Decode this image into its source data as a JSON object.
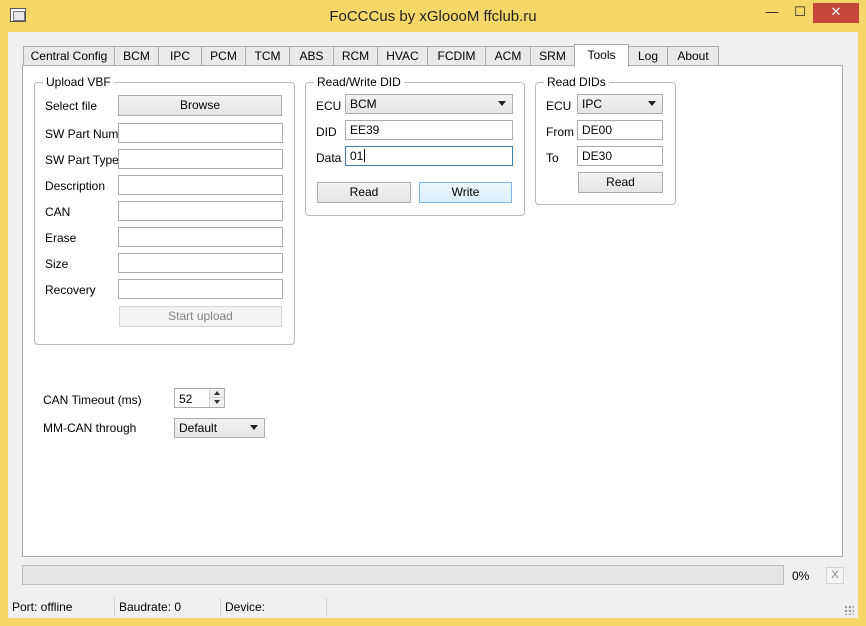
{
  "window": {
    "title": "FoCCCus by xGloooM ffclub.ru",
    "minimize_glyph": "—",
    "maximize_glyph": "☐",
    "close_glyph": "✕"
  },
  "tabs": [
    {
      "label": "Central Config",
      "active": false
    },
    {
      "label": "BCM",
      "active": false
    },
    {
      "label": "IPC",
      "active": false
    },
    {
      "label": "PCM",
      "active": false
    },
    {
      "label": "TCM",
      "active": false
    },
    {
      "label": "ABS",
      "active": false
    },
    {
      "label": "RCM",
      "active": false
    },
    {
      "label": "HVAC",
      "active": false
    },
    {
      "label": "FCDIM",
      "active": false
    },
    {
      "label": "ACM",
      "active": false
    },
    {
      "label": "SRM",
      "active": false
    },
    {
      "label": "Tools",
      "active": true
    },
    {
      "label": "Log",
      "active": false
    },
    {
      "label": "About",
      "active": false
    }
  ],
  "upload_vbf": {
    "title": "Upload VBF",
    "select_file_label": "Select file",
    "browse_label": "Browse",
    "fields": [
      {
        "label": "SW Part Num",
        "value": ""
      },
      {
        "label": "SW Part Type",
        "value": ""
      },
      {
        "label": "Description",
        "value": ""
      },
      {
        "label": "CAN",
        "value": ""
      },
      {
        "label": "Erase",
        "value": ""
      },
      {
        "label": "Size",
        "value": ""
      },
      {
        "label": "Recovery",
        "value": ""
      }
    ],
    "start_upload_label": "Start upload"
  },
  "can_timeout": {
    "label": "CAN Timeout (ms)",
    "value": "52"
  },
  "mm_can": {
    "label": "MM-CAN through",
    "value": "Default"
  },
  "read_write_did": {
    "title": "Read/Write DID",
    "ecu_label": "ECU",
    "ecu_value": "BCM",
    "did_label": "DID",
    "did_value": "EE39",
    "data_label": "Data",
    "data_value": "01",
    "read_label": "Read",
    "write_label": "Write"
  },
  "read_dids": {
    "title": "Read DIDs",
    "ecu_label": "ECU",
    "ecu_value": "IPC",
    "from_label": "From",
    "from_value": "DE00",
    "to_label": "To",
    "to_value": "DE30",
    "read_label": "Read"
  },
  "progress": {
    "value_percent": 0,
    "label": "0%",
    "cancel_label": "X"
  },
  "status": {
    "port": "Port: offline",
    "baudrate": "Baudrate: 0",
    "device": "Device:"
  },
  "colors": {
    "titlebar": "#f7d768",
    "close_button": "#c7463b",
    "focus_border": "#3c7fb1",
    "progress_fill": "#06b025"
  }
}
